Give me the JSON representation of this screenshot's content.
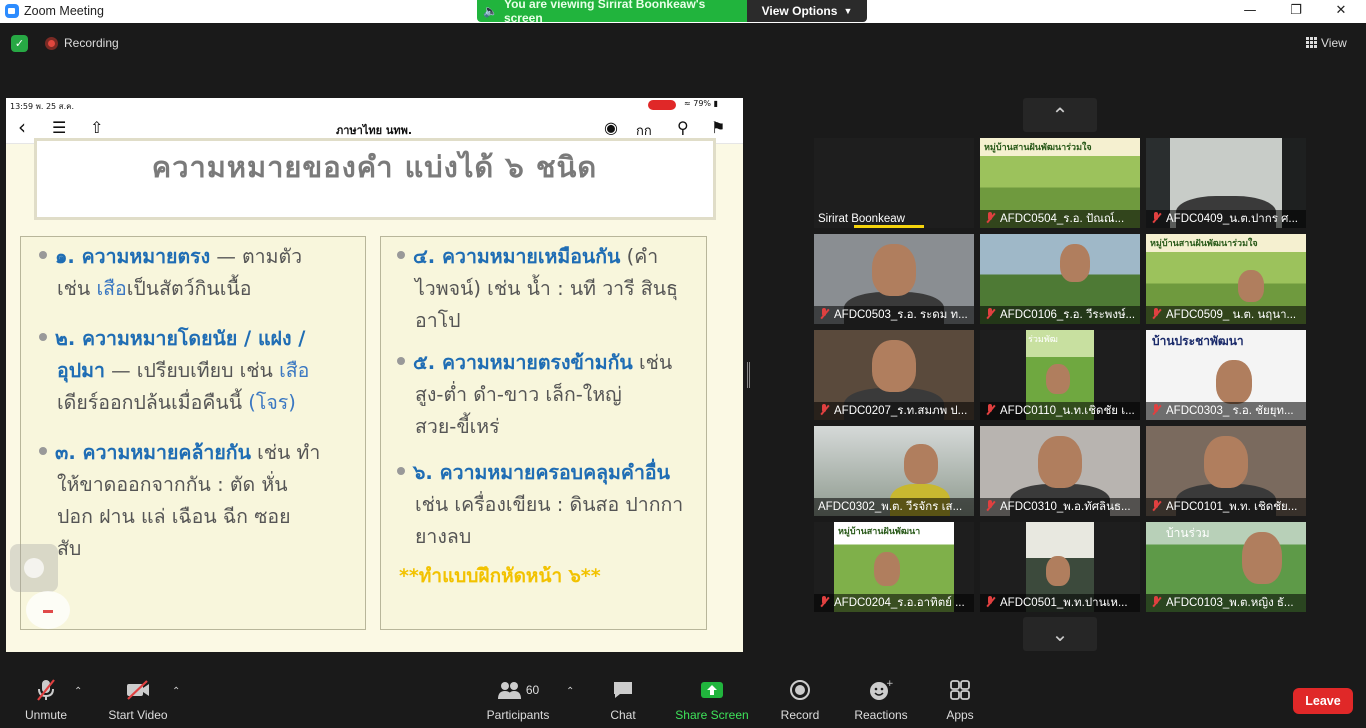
{
  "window": {
    "title": "Zoom Meeting",
    "minimize": "—",
    "restore": "❐",
    "close": "✕"
  },
  "banner": {
    "viewing_text": "You are viewing Sirirat Boonkeaw's screen",
    "view_options": "View Options"
  },
  "topbar": {
    "recording_label": "Recording",
    "view_label": "View"
  },
  "shared_screen": {
    "status_time": "13:59  พ. 25 ส.ค.",
    "battery": "79%",
    "doc_title": "ภาษาไทย นทพ.",
    "font_btn": "กก",
    "slide_title": "ความหมายของคำ แบ่งได้ ๖ ชนิด",
    "left_points": [
      {
        "num": "๑. ความหมายตรง",
        "rest": " — ตามตัว",
        "line2a": "เช่น ",
        "line2b": "เสือ",
        "line2c": "เป็นสัตว์กินเนื้อ"
      },
      {
        "num": "๒. ความหมายโดยนัย / แฝง /",
        "num2": "อุปมา",
        "rest": " — เปรียบเทียบ เช่น ",
        "blue": "เสือ",
        "line3a": "เดียร์ออกปล้นเมื่อคืนนี้ ",
        "line3b": "(โจร)"
      },
      {
        "num": "๓. ความหมายคล้ายกัน",
        "rest": " เช่น ทำ",
        "line2": "ให้ขาดออกจากกัน : ตัด หั่น",
        "line3": "ปอก ฝาน แล่ เฉือน ฉีก ซอย",
        "line4": "สับ"
      }
    ],
    "right_points": [
      {
        "num": "๔. ความหมายเหมือนกัน",
        "rest": " (คำ",
        "line2": "ไวพจน์) เช่น น้ำ : นที วารี สินธุ",
        "line3": "อาโป"
      },
      {
        "num": "๕. ความหมายตรงข้ามกัน",
        "rest": " เช่น",
        "line2": "สูง-ต่ำ   ดำ-ขาว   เล็ก-ใหญ่",
        "line3": "สวย-ขี้เหร่"
      },
      {
        "num": "๖. ความหมายครอบคลุมคำอื่น",
        "line2": "เช่น เครื่องเขียน : ดินสอ ปากกา",
        "line3": "ยางลบ"
      }
    ],
    "exercise": "**ทำแบบฝึกหัดหน้า ๖**"
  },
  "gallery": {
    "tiles": [
      {
        "name": "Sirirat Boonkeaw",
        "muted": false,
        "bg": "#1e1e1e",
        "active": true,
        "kind": "blank"
      },
      {
        "name": "AFDC0504_ร.อ. ปัณณ์...",
        "muted": true,
        "bg": "#8fb35a",
        "kind": "art",
        "art_text": "หมู่บ้านสานฝันพัฒนาร่วมใจ"
      },
      {
        "name": "AFDC0409_น.ต.ปากร ศ...",
        "muted": true,
        "bg": "#2a2e2f",
        "kind": "room"
      },
      {
        "name": "AFDC0503_ร.อ. ระดม ท...",
        "muted": true,
        "bg": "#8a8e92",
        "kind": "face"
      },
      {
        "name": "AFDC0106_ร.อ. วีระพงษ์...",
        "muted": true,
        "bg": "#6f8f9a",
        "kind": "field"
      },
      {
        "name": "AFDC0509_ น.ต. นฤนา...",
        "muted": true,
        "bg": "#8fb35a",
        "kind": "art",
        "art_text": "หมู่บ้านสานฝันพัฒนาร่วมใจ"
      },
      {
        "name": "AFDC0207_ร.ท.สมภพ ป...",
        "muted": true,
        "bg": "#5a4a3c",
        "kind": "face"
      },
      {
        "name": "AFDC0110_น.ท.เชิดชัย เ...",
        "muted": true,
        "bg": "#1e1e1e",
        "kind": "small-field",
        "art_text": "ร่วมพัฒ"
      },
      {
        "name": "AFDC0303_ ร.อ. ชัยยุท...",
        "muted": true,
        "bg": "#f2f2f2",
        "kind": "sign",
        "art_text": "บ้านประชาพัฒนา"
      },
      {
        "name": "AFDC0302_พ.ต. วีรจักร  เส...",
        "muted": false,
        "bg": "#b9c0c0",
        "kind": "fog"
      },
      {
        "name": "AFDC0310_พ.อ.ทัศลินธ...",
        "muted": true,
        "bg": "#b8b4b0",
        "kind": "face"
      },
      {
        "name": "AFDC0101_พ.ท. เชิดชัย...",
        "muted": true,
        "bg": "#7a6a5e",
        "kind": "face"
      },
      {
        "name": "AFDC0204_ร.อ.อาทิตย์ ...",
        "muted": true,
        "bg": "#1e1e1e",
        "kind": "small-art",
        "art_text": "หมู่บ้านสานฝันพัฒนา"
      },
      {
        "name": "AFDC0501_พ.ท.ปานเห...",
        "muted": true,
        "bg": "#1e1e1e",
        "kind": "small-room"
      },
      {
        "name": "AFDC0103_พ.ต.หญิง ธั...",
        "muted": true,
        "bg": "#6aa050",
        "kind": "field-face",
        "art_text": "บ้านร่วม"
      }
    ]
  },
  "toolbar": {
    "unmute": "Unmute",
    "start_video": "Start Video",
    "participants": "Participants",
    "participants_count": "60",
    "chat": "Chat",
    "share_screen": "Share Screen",
    "record": "Record",
    "reactions": "Reactions",
    "apps": "Apps",
    "leave": "Leave"
  },
  "colors": {
    "share_green": "#21b43d",
    "leave_red": "#e02828",
    "heading_blue": "#1f6db4",
    "exercise_yellow": "#f2c200"
  }
}
